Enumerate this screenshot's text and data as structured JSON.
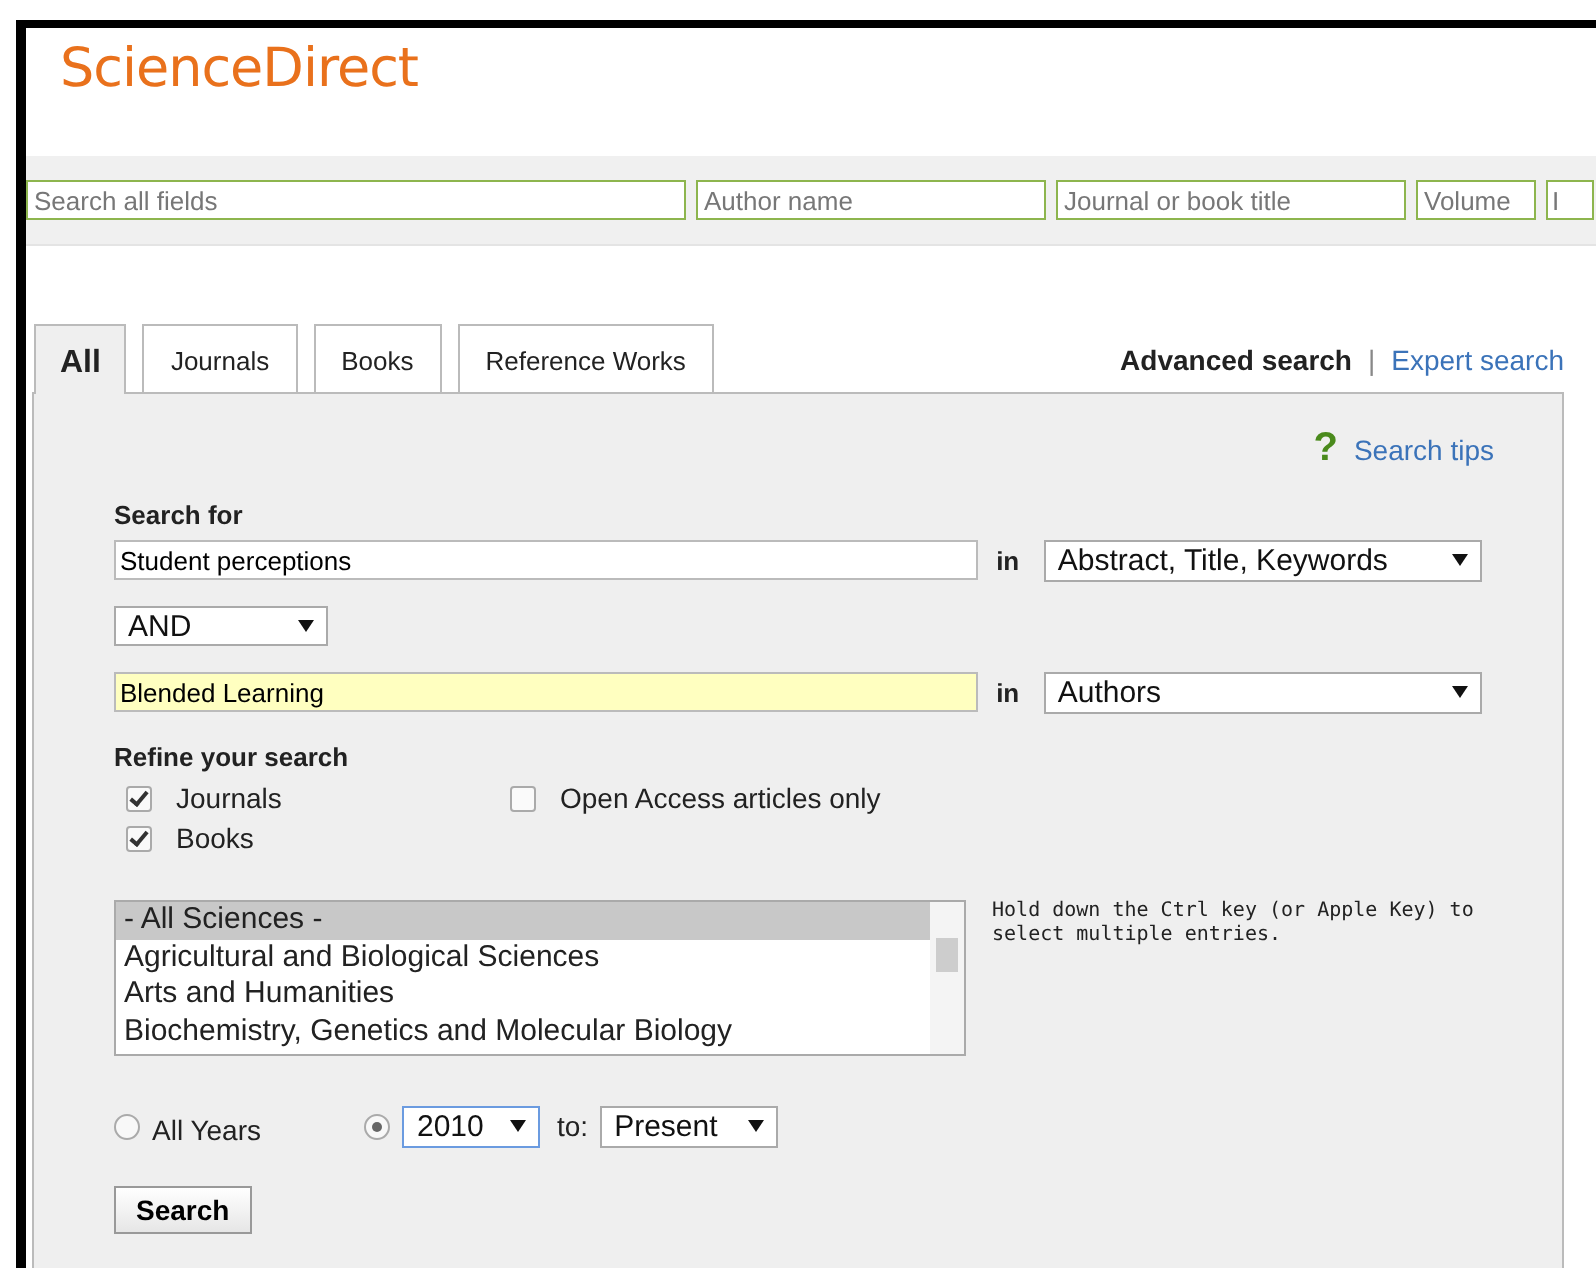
{
  "logo": "ScienceDirect",
  "quick_search": [
    {
      "placeholder": "Search all fields"
    },
    {
      "placeholder": "Author name"
    },
    {
      "placeholder": "Journal or book title"
    },
    {
      "placeholder": "Volume"
    },
    {
      "placeholder": "I"
    }
  ],
  "tabs": [
    {
      "label": "All",
      "selected": true
    },
    {
      "label": "Journals",
      "selected": false
    },
    {
      "label": "Books",
      "selected": false
    },
    {
      "label": "Reference Works",
      "selected": false
    }
  ],
  "search_modes": [
    {
      "label": "Advanced search",
      "selected": true
    },
    {
      "label": "Expert search",
      "selected": false
    }
  ],
  "mode_separator": "|",
  "search_tips": {
    "icon": "?",
    "label": "Search tips"
  },
  "search_for": {
    "label": "Search for",
    "terms": [
      {
        "value": "Student perceptions",
        "highlighted": false,
        "in_label": "in",
        "field": "Abstract, Title, Keywords"
      },
      {
        "value": "Blended Learning",
        "highlighted": true,
        "in_label": "in",
        "field": "Authors"
      }
    ],
    "operator": "AND"
  },
  "refine": {
    "label": "Refine your search",
    "options": [
      {
        "label": "Journals",
        "checked": true
      },
      {
        "label": "Books",
        "checked": true
      },
      {
        "label": "Open Access articles only",
        "checked": false
      }
    ],
    "subjects": [
      {
        "label": "- All Sciences -",
        "selected": true
      },
      {
        "label": "Agricultural and Biological Sciences",
        "selected": false
      },
      {
        "label": "Arts and Humanities",
        "selected": false
      },
      {
        "label": "Biochemistry, Genetics and Molecular Biology",
        "selected": false
      }
    ],
    "hint": "Hold down the Ctrl key (or Apple Key) to select multiple entries."
  },
  "years": {
    "options": [
      {
        "label": "All Years",
        "selected": false
      },
      {
        "selected": true
      }
    ],
    "from": "2010",
    "to_label": "to:",
    "to": "Present"
  },
  "search_button": "Search"
}
